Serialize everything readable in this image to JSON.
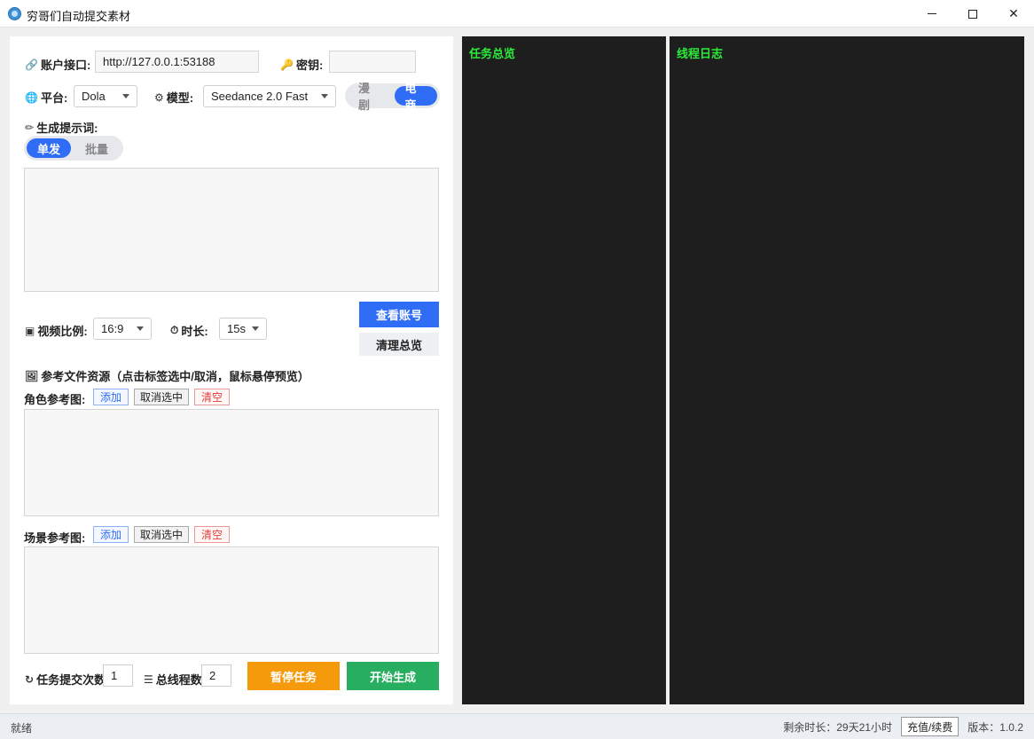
{
  "window": {
    "title": "穷哥们自动提交素材"
  },
  "account": {
    "api_label": "账户接口:",
    "api_value": "http://127.0.0.1:53188",
    "key_label": "密钥:",
    "key_value": ""
  },
  "platform": {
    "label": "平台:",
    "selected": "Dola"
  },
  "model": {
    "label": "模型:",
    "selected": "Seedance 2.0 Fast"
  },
  "mode_toggle": {
    "options": [
      "漫剧",
      "电商"
    ],
    "active": "电商"
  },
  "prompt": {
    "label": "生成提示词:",
    "tabs": [
      "单发",
      "批量"
    ],
    "active_tab": "单发",
    "value": ""
  },
  "video": {
    "ratio_label": "视频比例:",
    "ratio_value": "16:9",
    "duration_label": "时长:",
    "duration_value": "15s"
  },
  "actions": {
    "view_account": "查看账号",
    "clear_overview": "清理总览"
  },
  "references": {
    "title": "参考文件资源（点击标签选中/取消，鼠标悬停预览）",
    "character_label": "角色参考图:",
    "scene_label": "场景参考图:",
    "add": "添加",
    "deselect": "取消选中",
    "clear": "清空"
  },
  "bottom": {
    "submit_count_label": "任务提交次数:",
    "submit_count_value": "1",
    "threads_label": "总线程数:",
    "threads_value": "2",
    "pause": "暂停任务",
    "start": "开始生成"
  },
  "panels": {
    "overview_title": "任务总览",
    "log_title": "线程日志"
  },
  "status": {
    "left": "就绪",
    "remaining": "剩余时长：29天21小时",
    "recharge": "充值/续费",
    "version": "版本：1.0.2"
  },
  "colors": {
    "accent": "#2f6df6",
    "pause": "#f59a0b",
    "start": "#27ae60",
    "log_text": "#2dea3a",
    "panel_bg": "#1e1e1e"
  }
}
